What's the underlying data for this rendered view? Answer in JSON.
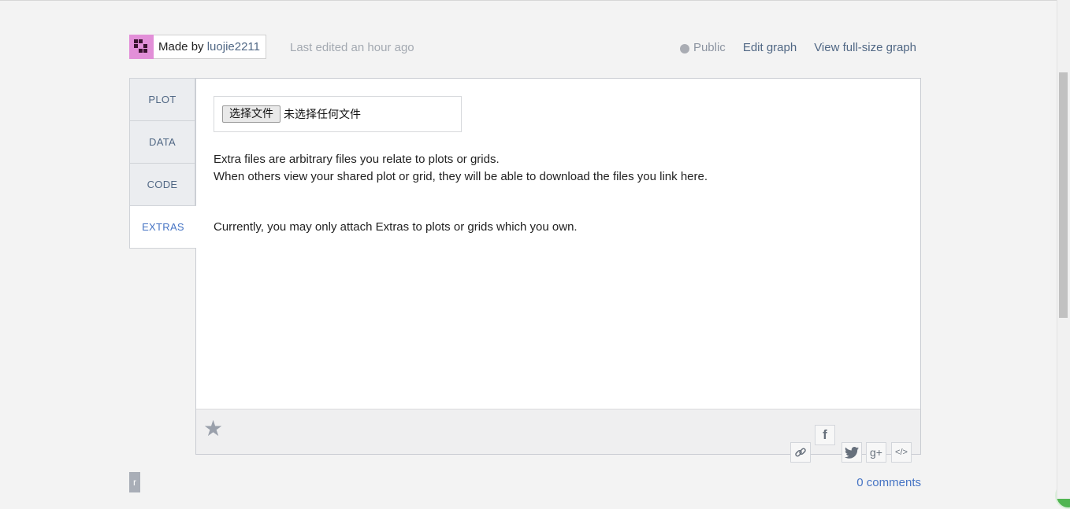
{
  "header": {
    "made_by_label": "Made by",
    "author": "luojie2211",
    "last_edited": "Last edited an hour ago",
    "visibility_label": "Public",
    "visibility_icon": "globe-icon",
    "edit_graph": "Edit graph",
    "view_full_size": "View full-size graph"
  },
  "tabs": [
    {
      "label": "PLOT",
      "active": false
    },
    {
      "label": "DATA",
      "active": false
    },
    {
      "label": "CODE",
      "active": false
    },
    {
      "label": "EXTRAS",
      "active": true
    }
  ],
  "extras": {
    "file_button": "选择文件",
    "file_status": "未选择任何文件",
    "description_line1": "Extra files are arbitrary files you relate to plots or grids.",
    "description_line2": "When others view your shared plot or grid, they will be able to download the files you link here.",
    "note": "Currently, you may only attach Extras to plots or grids which you own."
  },
  "footer": {
    "star_icon": "star-icon",
    "share_icons": [
      "link-icon",
      "facebook-icon",
      "twitter-icon",
      "google-plus-icon",
      "embed-icon"
    ],
    "facebook_glyph": "f",
    "google_plus_glyph": "g+",
    "embed_glyph": "</>"
  },
  "bottom": {
    "badge": "r",
    "comments": "0 comments"
  },
  "colors": {
    "background": "#f3f3f3",
    "link": "#506784",
    "active_tab": "#4674c4",
    "avatar": "#e28fd8"
  }
}
